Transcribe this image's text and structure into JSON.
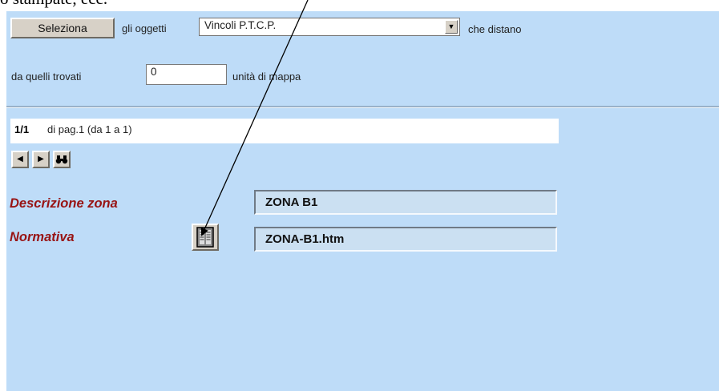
{
  "doc": {
    "caption": "o stampate, ecc."
  },
  "toolbar": {
    "select_button": "Seleziona",
    "objects_prefix": "gli oggetti",
    "layer_value": "Vincoli P.T.C.P.",
    "distance_suffix": "che distano",
    "from_found": "da quelli trovati",
    "distance_value": "0",
    "unit_label": "unità di mappa"
  },
  "pager": {
    "index": "1/1",
    "info": "di pag.1  (da 1 a 1)"
  },
  "nav": {
    "prev_icon": "arrow-left-icon",
    "next_icon": "arrow-right-icon",
    "search_icon": "binoculars-icon"
  },
  "record": {
    "desc_label": "Descrizione zona",
    "desc_value": "ZONA B1",
    "norm_label": "Normativa",
    "norm_value": "ZONA-B1.htm",
    "doc_icon": "document-icon"
  },
  "colors": {
    "panel": "#bedcf8",
    "label": "#981414",
    "field": "#cbe0f2"
  }
}
